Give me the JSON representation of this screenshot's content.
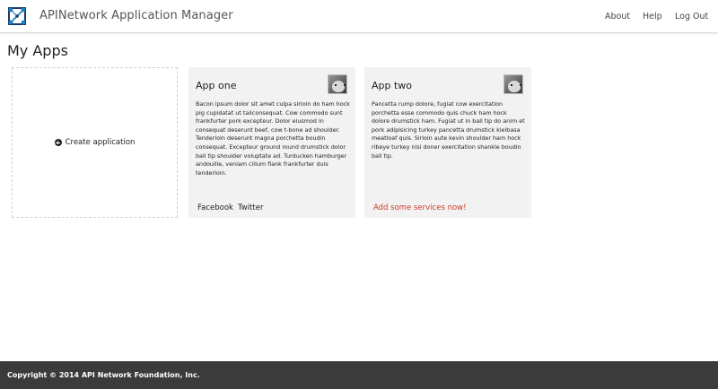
{
  "header": {
    "brand": "APINetwork Application Manager",
    "nav": {
      "about": "About",
      "help": "Help",
      "logout": "Log Out"
    }
  },
  "main": {
    "title": "My Apps",
    "create_label": "Create application",
    "apps": [
      {
        "name": "App one",
        "description": "Bacon ipsum dolor sit amet culpa sirloin do ham hock pig cupidatat ut tailconsequat. Cow commodo sunt frankfurter pork excepteur. Dolor eiusmod in consequat deserunt beef, cow t-bone ad shoulder. Tenderloin deserunt magna porchetta boudin consequat. Excepteur ground round drumstick dolor ball tip shoulder voluptate ad. Turducken hamburger andouille, veniam cillum flank frankfurter duis tenderloin.",
        "services": [
          "Facebook",
          "Twitter"
        ]
      },
      {
        "name": "App two",
        "description": "Pancetta rump dolore, fugiat cow exercitation porchetta esse commodo quis chuck ham hock dolore drumstick ham. Fugiat ut in ball tip do anim et pork adipisicing turkey pancetta drumstick kielbasa meatloaf quis. Sirloin aute kevin shoulder ham hock ribeye turkey nisi doner exercitation shankle boudin ball tip.",
        "add_services": "Add some services now!"
      }
    ]
  },
  "footer": {
    "copyright": "Copyright © 2014 API Network Foundation, Inc."
  },
  "colors": {
    "card_bg": "#f2f2f2",
    "footer_bg": "#3b3b3b",
    "accent_red": "#cc3b2b",
    "logo_blue": "#1f7fc4"
  },
  "icons": {
    "logo": "network-logo-icon",
    "create": "plus-circle-icon",
    "avatar": "cat-avatar-icon"
  }
}
